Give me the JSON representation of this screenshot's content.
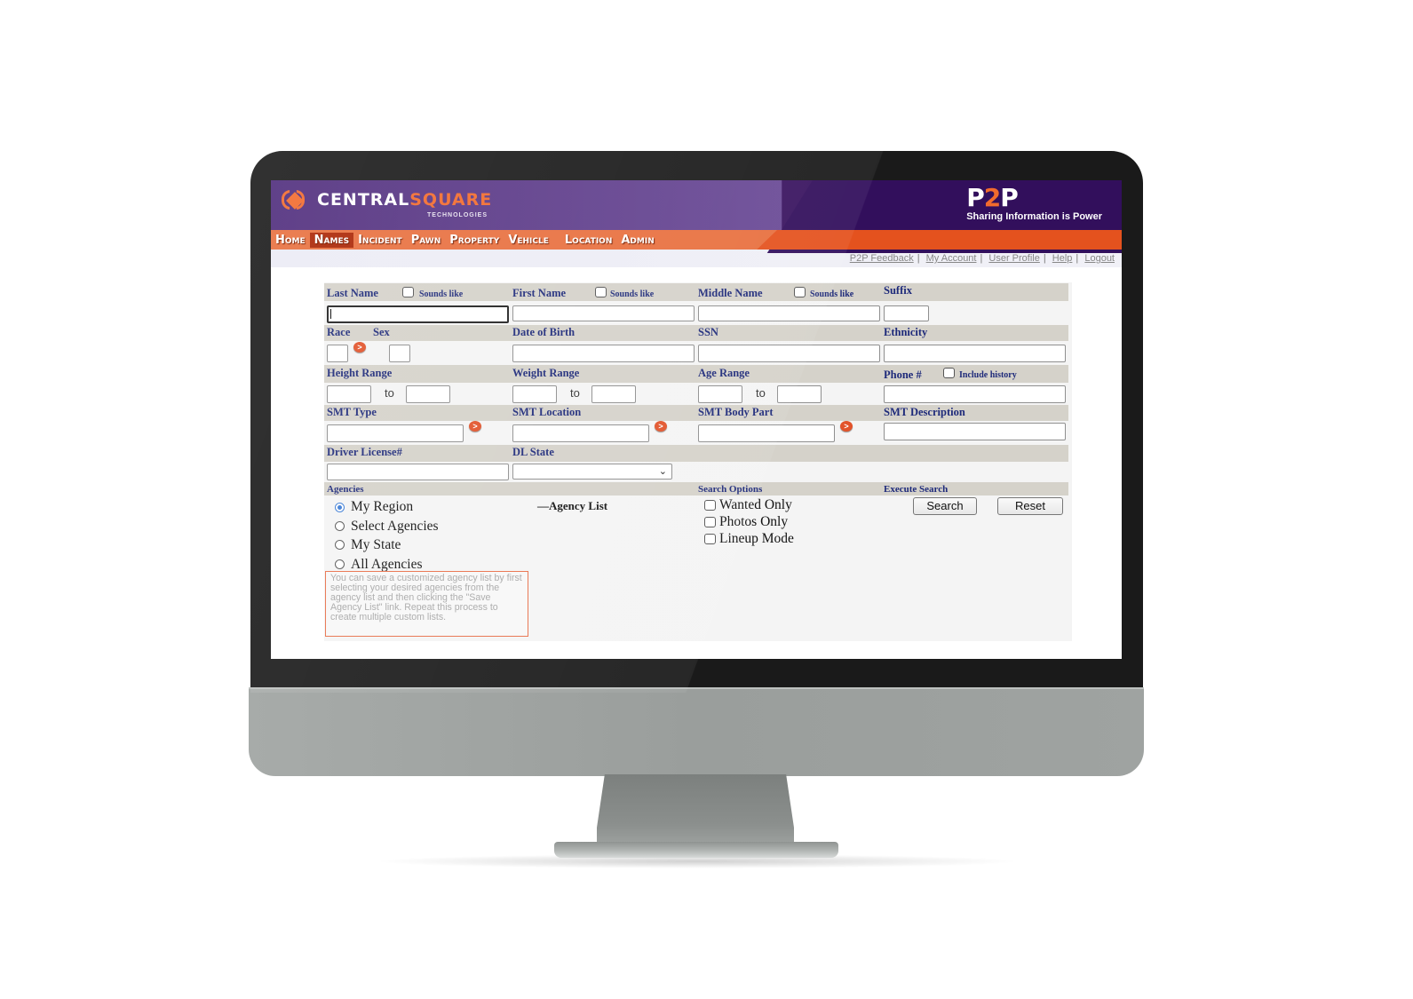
{
  "brand": {
    "company": "CENTRAL",
    "company_accent": "SQUARE",
    "company_sub": "TECHNOLOGIES",
    "product_mark_a": "P",
    "product_mark_b": "2",
    "product_mark_c": "P",
    "tagline": "Sharing Information is Power"
  },
  "nav": {
    "items": [
      {
        "label": "Home",
        "active": false
      },
      {
        "label": "Names",
        "active": true
      },
      {
        "label": "Incident",
        "active": false
      },
      {
        "label": "Pawn",
        "active": false
      },
      {
        "label": "Property",
        "active": false
      },
      {
        "label": "Vehicle",
        "active": false
      },
      {
        "label": "Location",
        "active": false
      },
      {
        "label": "Admin",
        "active": false
      }
    ]
  },
  "links": {
    "items": [
      "P2P Feedback",
      "My Account",
      "User Profile",
      "Help",
      "Logout"
    ],
    "separator": "|"
  },
  "form": {
    "last_name": {
      "label": "Last Name",
      "sounds_like": "Sounds like",
      "value": ""
    },
    "first_name": {
      "label": "First Name",
      "sounds_like": "Sounds like",
      "value": ""
    },
    "middle_name": {
      "label": "Middle Name",
      "sounds_like": "Sounds like",
      "value": ""
    },
    "suffix": {
      "label": "Suffix",
      "value": ""
    },
    "race": {
      "label": "Race",
      "value": ""
    },
    "sex": {
      "label": "Sex",
      "value": ""
    },
    "dob": {
      "label": "Date of Birth",
      "value": ""
    },
    "ssn": {
      "label": "SSN",
      "value": ""
    },
    "ethnicity": {
      "label": "Ethnicity",
      "value": ""
    },
    "height": {
      "label": "Height Range",
      "to": "to"
    },
    "weight": {
      "label": "Weight Range",
      "to": "to"
    },
    "age": {
      "label": "Age Range",
      "to": "to"
    },
    "phone": {
      "label": "Phone #",
      "include_history": "Include history",
      "value": ""
    },
    "smt_type": {
      "label": "SMT Type",
      "value": ""
    },
    "smt_location": {
      "label": "SMT Location",
      "value": ""
    },
    "smt_body_part": {
      "label": "SMT Body Part",
      "value": ""
    },
    "smt_description": {
      "label": "SMT Description",
      "value": ""
    },
    "driver_license": {
      "label": "Driver License#",
      "value": ""
    },
    "dl_state": {
      "label": "DL State",
      "selected": ""
    },
    "lookup_glyph": ">"
  },
  "agencies": {
    "label": "Agencies",
    "options": [
      {
        "label": "My Region",
        "selected": true
      },
      {
        "label": "Select Agencies",
        "selected": false
      },
      {
        "label": "My State",
        "selected": false
      },
      {
        "label": "All Agencies",
        "selected": false
      }
    ],
    "agency_list_label": "—Agency List",
    "note": "You can save a customized agency list by first selecting your desired agencies from the agency list and then clicking the \"Save Agency List\" link. Repeat this process to create multiple custom lists."
  },
  "search_options": {
    "label": "Search Options",
    "options": [
      {
        "label": "Wanted Only",
        "checked": false
      },
      {
        "label": "Photos Only",
        "checked": false
      },
      {
        "label": "Lineup Mode",
        "checked": false
      }
    ]
  },
  "execute": {
    "label": "Execute Search",
    "search_button": "Search",
    "reset_button": "Reset"
  },
  "colors": {
    "brand_purple": "#4f2c7c",
    "brand_orange": "#e4521e",
    "label_navy": "#1e2a7a",
    "header_row": "#d5d2ca"
  }
}
